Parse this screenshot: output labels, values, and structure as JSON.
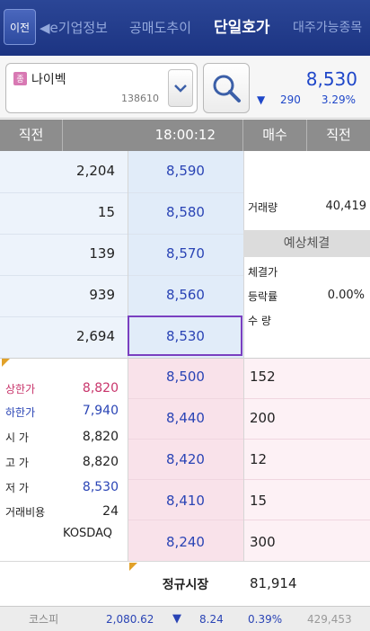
{
  "colors": {
    "tab_bar": "#2b4696",
    "down_blue": "#2a44b5",
    "up_red": "#c8356b",
    "highlight": "#7a3fc0"
  },
  "nav": {
    "back_label": "이전",
    "tabs": [
      {
        "label": "◀e기업정보"
      },
      {
        "label": "공매도추이"
      },
      {
        "label": "단일호가"
      },
      {
        "label": "대주가능종목"
      }
    ],
    "active_tab": "단일호가"
  },
  "stock": {
    "badge": "종",
    "name": "나이벡",
    "code": "138610",
    "price": "8,530",
    "change_arrow": "▼",
    "change": "290",
    "change_rate": "3.29%"
  },
  "table_header": {
    "prev_left": "직전",
    "time": "18:00:12",
    "bid": "매수",
    "prev_right": "직전"
  },
  "asks": [
    {
      "qty": "2,204",
      "price": "8,590"
    },
    {
      "qty": "15",
      "price": "8,580"
    },
    {
      "qty": "139",
      "price": "8,570"
    },
    {
      "qty": "939",
      "price": "8,560"
    },
    {
      "qty": "2,694",
      "price": "8,530"
    }
  ],
  "bids": [
    {
      "price": "8,500",
      "qty": "152"
    },
    {
      "price": "8,440",
      "qty": "200"
    },
    {
      "price": "8,420",
      "qty": "12"
    },
    {
      "price": "8,410",
      "qty": "15"
    },
    {
      "price": "8,240",
      "qty": "300"
    }
  ],
  "right_panel": {
    "volume_label": "거래량",
    "volume_value": "40,419",
    "expected_header": "예상체결",
    "exec_price_label": "체결가",
    "change_rate_label": "등락률",
    "change_rate_value": "0.00%",
    "quantity_label": "수   량"
  },
  "summary": {
    "upper_limit_label": "상한가",
    "upper_limit": "8,820",
    "lower_limit_label": "하한가",
    "lower_limit": "7,940",
    "open_label": "시   가",
    "open": "8,820",
    "high_label": "고   가",
    "high": "8,820",
    "low_label": "저   가",
    "low": "8,530",
    "volume_ratio_label": "거래비용",
    "volume_ratio": "24",
    "market": "KOSDAQ"
  },
  "totals": {
    "session": "정규시장",
    "bid_total": "81,914"
  },
  "footer": {
    "index_name": "코스피",
    "index_value": "2,080.62",
    "arrow": "▼",
    "change": "8.24",
    "rate": "0.39%",
    "volume": "429,453"
  }
}
